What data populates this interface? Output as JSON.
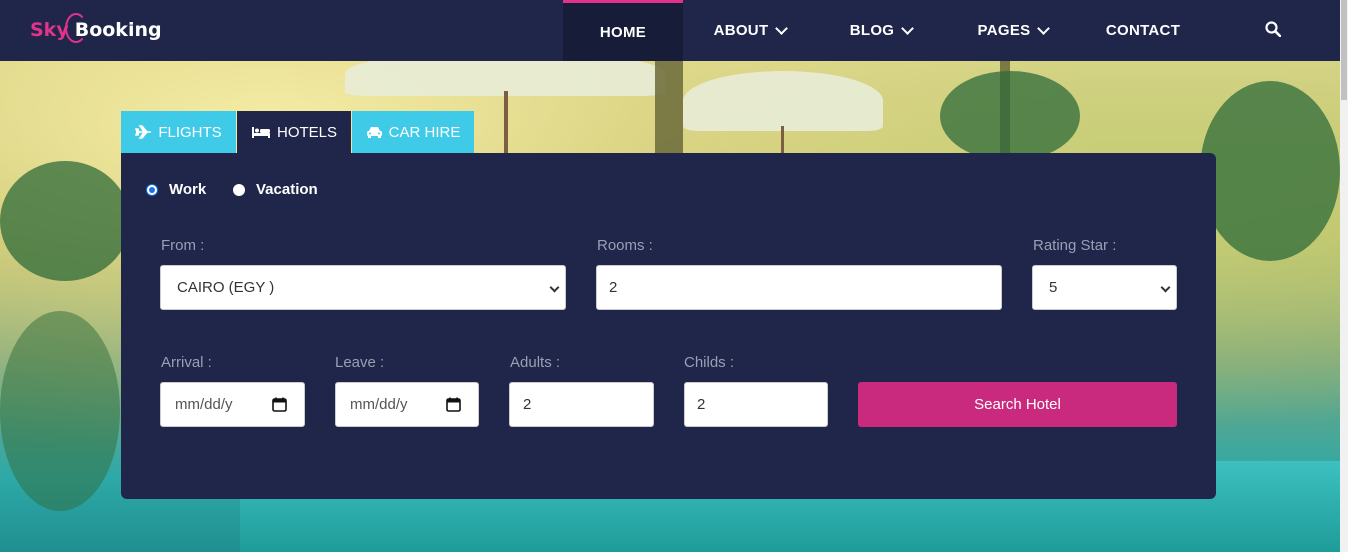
{
  "logo": {
    "part1": "Sky",
    "part2": "Booking"
  },
  "nav": {
    "home": "HOME",
    "about": "ABOUT",
    "blog": "BLOG",
    "pages": "PAGES",
    "contact": "CONTACT"
  },
  "tabs": {
    "flights": "FLIGHTS",
    "hotels": "HOTELS",
    "car_hire": "CAR HIRE",
    "active": "HOTELS"
  },
  "trip_type": {
    "work": "Work",
    "vacation": "Vacation",
    "selected": "Work"
  },
  "form": {
    "from_label": "From :",
    "from_value": "CAIRO (EGY )",
    "rooms_label": "Rooms :",
    "rooms_value": "2",
    "rating_label": "Rating Star :",
    "rating_value": "5",
    "arrival_label": "Arrival :",
    "arrival_placeholder": "mm/dd/y",
    "leave_label": "Leave :",
    "leave_placeholder": "mm/dd/y",
    "adults_label": "Adults :",
    "adults_value": "2",
    "childs_label": "Childs :",
    "childs_value": "2",
    "search_button": "Search Hotel"
  },
  "colors": {
    "navy": "#1f2649",
    "accent": "#e1338c",
    "button": "#c92a7d",
    "tab_light": "#3fcbe8"
  },
  "icons": {
    "search": "search-icon",
    "flights": "plane-icon",
    "hotels": "bed-icon",
    "car_hire": "car-icon",
    "calendar": "calendar-icon"
  }
}
